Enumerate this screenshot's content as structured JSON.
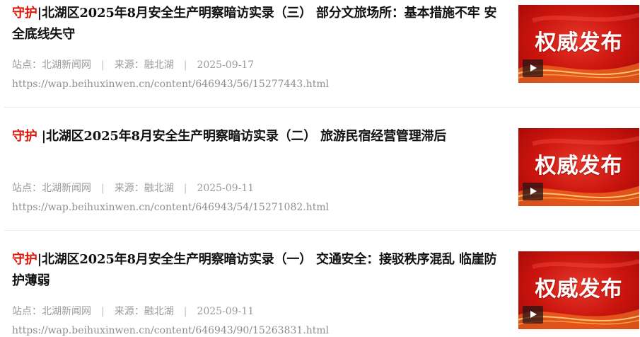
{
  "colors": {
    "highlight": "#d6180b",
    "title": "#111111",
    "meta": "#9a9a9a",
    "thumb_red": "#c9140d"
  },
  "results": [
    {
      "title_highlight": "守护",
      "title_rest": "|北湖区2025年8月安全生产明察暗访实录（三） 部分文旅场所：基本措施不牢 安全底线失守",
      "site_label": "站点：北湖新闻网",
      "source_label": "来源：融北湖",
      "date": "2025-09-17",
      "url": "https://wap.beihuxinwen.cn/content/646943/56/15277443.html",
      "thumb_text": "权威发布",
      "thumb_icon": "play-icon"
    },
    {
      "title_highlight": "守护",
      "title_rest": " |北湖区2025年8月安全生产明察暗访实录（二） 旅游民宿经营管理滞后",
      "site_label": "站点：北湖新闻网",
      "source_label": "来源：融北湖",
      "date": "2025-09-11",
      "url": "https://wap.beihuxinwen.cn/content/646943/54/15271082.html",
      "thumb_text": "权威发布",
      "thumb_icon": "play-icon"
    },
    {
      "title_highlight": "守护",
      "title_rest": "|北湖区2025年8月安全生产明察暗访实录（一） 交通安全：接驳秩序混乱 临崖防护薄弱",
      "site_label": "站点：北湖新闻网",
      "source_label": "来源：融北湖",
      "date": "2025-09-11",
      "url": "https://wap.beihuxinwen.cn/content/646943/90/15263831.html",
      "thumb_text": "权威发布",
      "thumb_icon": "play-icon"
    }
  ]
}
